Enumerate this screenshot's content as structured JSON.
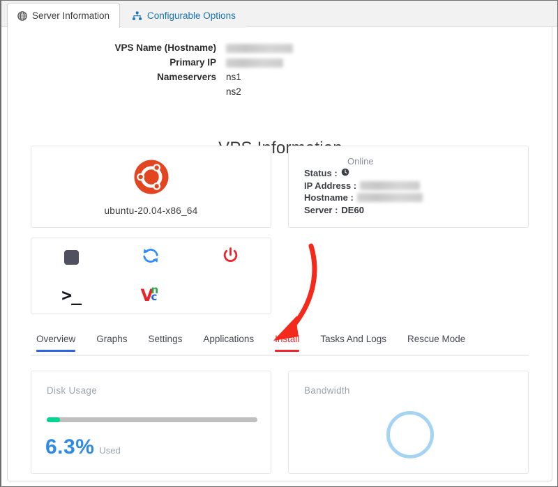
{
  "window": {
    "tabs": [
      {
        "label": "Server Information",
        "icon": "globe-icon",
        "active": true
      },
      {
        "label": "Configurable Options",
        "icon": "sitemap-icon",
        "active": false
      }
    ]
  },
  "summary": {
    "rows": [
      {
        "label": "VPS Name (Hostname)",
        "value": "",
        "redacted": true
      },
      {
        "label": "Primary IP",
        "value": "",
        "redacted": true
      },
      {
        "label": "Nameservers",
        "value": "ns1",
        "redacted": false
      },
      {
        "label": "",
        "value": "ns2",
        "redacted": false
      }
    ]
  },
  "page_title": "VPS Information",
  "os_card": {
    "icon": "ubuntu-icon",
    "label": "ubuntu-20.04-x86_64"
  },
  "status_card": {
    "online_text": "Online",
    "status_label": "Status :",
    "status_icon": "clock-icon",
    "ip_label": "IP Address :",
    "ip_value": "",
    "hostname_label": "Hostname :",
    "hostname_value": "",
    "server_label": "Server :",
    "server_value": "DE60"
  },
  "actions": [
    {
      "name": "stop-button",
      "icon": "stop-square-icon"
    },
    {
      "name": "reboot-button",
      "icon": "refresh-icon"
    },
    {
      "name": "power-button",
      "icon": "power-icon"
    },
    {
      "name": "console-button",
      "icon": "terminal-icon",
      "glyph": ">_"
    },
    {
      "name": "vnc-button",
      "icon": "vnc-icon",
      "letters": [
        "V",
        "n",
        "c"
      ]
    }
  ],
  "nav_tabs": [
    {
      "label": "Overview",
      "state": "active-blue"
    },
    {
      "label": "Graphs",
      "state": "normal"
    },
    {
      "label": "Settings",
      "state": "normal"
    },
    {
      "label": "Applications",
      "state": "normal"
    },
    {
      "label": "Install",
      "state": "active-red"
    },
    {
      "label": "Tasks And Logs",
      "state": "normal"
    },
    {
      "label": "Rescue Mode",
      "state": "normal"
    }
  ],
  "disk_card": {
    "title": "Disk Usage",
    "percent": "6.3%",
    "percent_value": 6.3,
    "suffix": "Used"
  },
  "bandwidth_card": {
    "title": "Bandwidth"
  },
  "annotation": {
    "type": "curved-arrow",
    "color": "#f4281b",
    "points_to": "Install"
  },
  "colors": {
    "accent_blue": "#2e8ae6",
    "active_tab_blue": "#2f63e8",
    "alert_red": "#f5232b",
    "progress_green": "#00d793",
    "ring_blue": "#a5d4f2",
    "ubuntu_orange": "#e2451f"
  }
}
